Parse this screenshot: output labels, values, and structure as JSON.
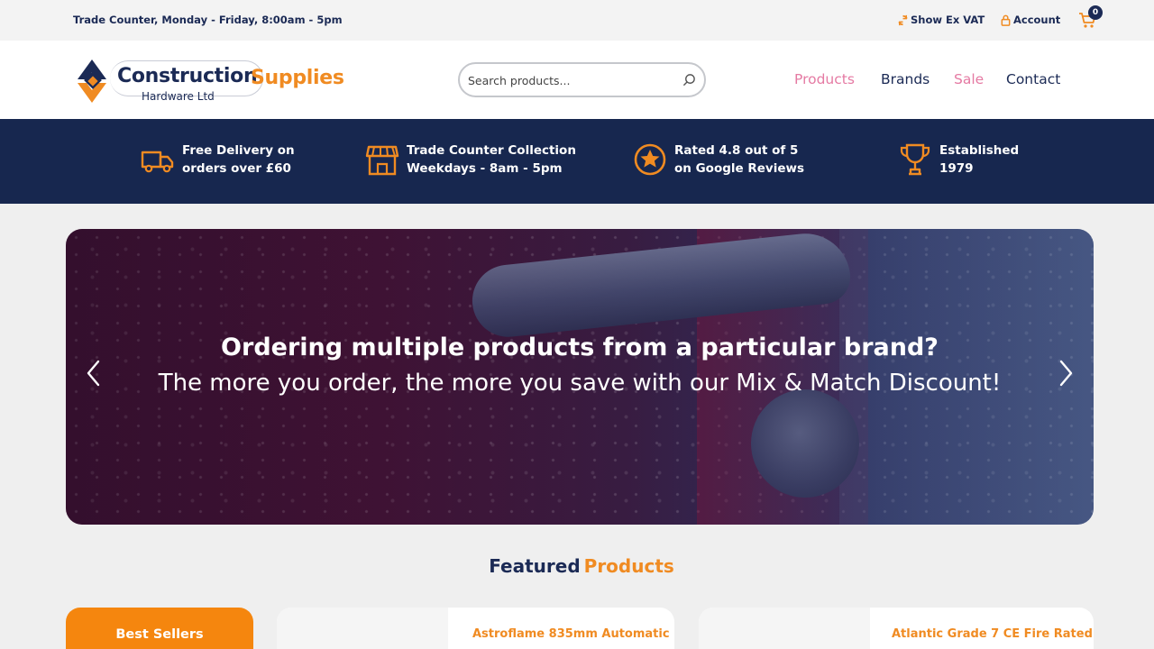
{
  "topbar": {
    "hours": "Trade Counter, Monday - Friday, 8:00am - 5pm",
    "vat_toggle": "Show Ex VAT",
    "account": "Account",
    "cart_count": "0"
  },
  "header": {
    "logo": {
      "word1": "Construction",
      "word2": "Supplies",
      "sub": "Hardware Ltd"
    },
    "search": {
      "placeholder": "Search products..."
    },
    "nav": [
      "Products",
      "Brands",
      "Sale",
      "Contact"
    ]
  },
  "usps": [
    {
      "icon": "delivery-truck-icon",
      "line1": "Free Delivery on",
      "line2": "orders over £60"
    },
    {
      "icon": "storefront-icon",
      "line1": "Trade Counter Collection",
      "line2": "Weekdays - 8am - 5pm"
    },
    {
      "icon": "star-badge-icon",
      "line1": "Rated 4.8 out of 5",
      "line2": "on Google Reviews"
    },
    {
      "icon": "trophy-icon",
      "line1": "Established",
      "line2": "1979"
    }
  ],
  "hero": {
    "headline": "Ordering multiple products from a particular brand?",
    "subline": "The more you order, the more you save with our Mix & Match Discount!"
  },
  "featured": {
    "title_part1": "Featured",
    "title_part2": "Products",
    "tab": "Best Sellers",
    "products": [
      {
        "title": "Astroflame 835mm Automatic"
      },
      {
        "title": "Atlantic Grade 7 CE Fire Rated"
      }
    ]
  },
  "colors": {
    "navy": "#1b2a55",
    "orange": "#f08b22",
    "pink_link": "#e57aa3",
    "usp_band": "#17274f"
  }
}
